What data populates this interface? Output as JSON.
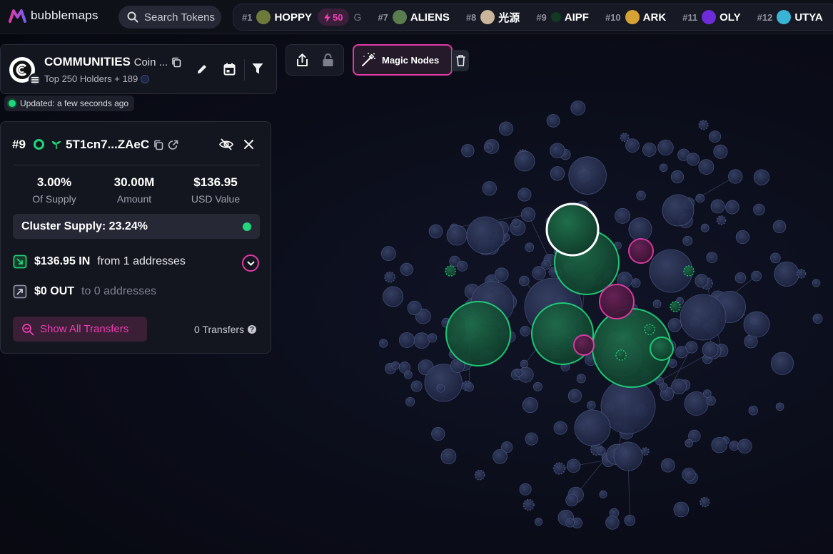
{
  "app": {
    "name": "bubblemaps"
  },
  "search": {
    "label": "Search Tokens"
  },
  "ticker": {
    "items": [
      {
        "rank": "#1",
        "name": "HOPPY",
        "avatar_color": "#6e7a3a",
        "boost": "50"
      },
      {
        "rank": "#7",
        "name": "ALIENS",
        "avatar_color": "#5a7d4e"
      },
      {
        "rank": "#8",
        "name": "光源",
        "avatar_color": "#c9b59b"
      },
      {
        "rank": "#9",
        "name": "AIPF",
        "avatar_color": "#1e4d2b"
      },
      {
        "rank": "#10",
        "name": "ARK",
        "avatar_color": "#d6a233"
      },
      {
        "rank": "#11",
        "name": "OLY",
        "avatar_color": "#6d2bd9"
      },
      {
        "rank": "#12",
        "name": "UTYA",
        "avatar_color": "#3ab4d6"
      }
    ],
    "partial": "G"
  },
  "map": {
    "title_bold": "COMMUNITIES",
    "title_rest": "Coin ...",
    "subtitle": "Top 250 Holders + 189",
    "updated": "Updated: a few seconds ago"
  },
  "actions": {
    "magic_nodes": "Magic Nodes"
  },
  "wallet": {
    "rank": "#9",
    "address": "5T1cn7...ZAeC",
    "stats": [
      {
        "value": "3.00%",
        "label": "Of Supply"
      },
      {
        "value": "30.00M",
        "label": "Amount"
      },
      {
        "value": "$136.95",
        "label": "USD Value"
      }
    ],
    "cluster_supply": "Cluster Supply: 23.24%",
    "in": {
      "amount": "$136.95 IN",
      "detail": "from 1 addresses"
    },
    "out": {
      "amount": "$0 OUT",
      "detail": "to 0 addresses"
    },
    "show_all": "Show All Transfers",
    "transfers": "0 Transfers"
  },
  "colors": {
    "accent_pink": "#e13aa7",
    "cluster_green": "#1fd67c",
    "node_blue": "#2a3352"
  }
}
